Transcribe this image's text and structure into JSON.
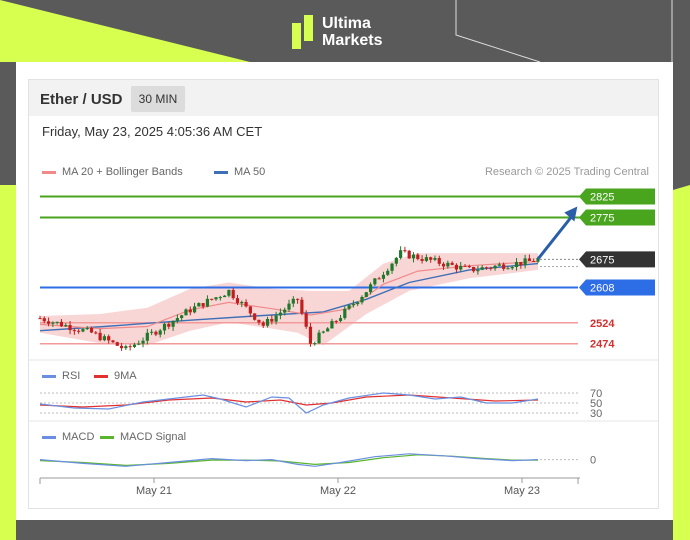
{
  "brand": {
    "line1": "Ultima",
    "line2": "Markets"
  },
  "header": {
    "symbol": "Ether / USD",
    "interval": "30 MIN"
  },
  "datetime": "Friday, May 23, 2025 4:05:36 AM CET",
  "colors": {
    "lime": "#d7ff4f",
    "green_level": "#4aa51e",
    "blue_level": "#2d6ee6",
    "red_level": "#f29a9a",
    "current": "#333333",
    "ma20": "#f08a8a",
    "ma50": "#3f6fb6",
    "rsi": "#6b8fe0",
    "nine_ma": "#e03030",
    "macd": "#6b8fe0",
    "macd_signal": "#5ab52e",
    "candle_up": "#1e7a2a",
    "candle_down": "#c21e1e",
    "band": "#f8cccc"
  },
  "chart_data": [
    {
      "type": "candlestick",
      "legend": [
        {
          "name": "MA 20 + Bollinger Bands",
          "color": "#f08a8a"
        },
        {
          "name": "MA 50",
          "color": "#3f6fb6"
        }
      ],
      "credit": "Research © 2025 Trading Central",
      "x_ticks": [
        "May 21",
        "May 22",
        "May 23"
      ],
      "ylim": [
        2440,
        2850
      ],
      "levels": [
        {
          "value": 2825,
          "label": "2825",
          "kind": "resistance"
        },
        {
          "value": 2775,
          "label": "2775",
          "kind": "resistance"
        },
        {
          "value": 2675,
          "label": "2675",
          "kind": "current"
        },
        {
          "value": 2608,
          "label": "2608",
          "kind": "pivot"
        },
        {
          "value": 2524,
          "label": "2524",
          "kind": "support"
        },
        {
          "value": 2474,
          "label": "2474",
          "kind": "support"
        }
      ],
      "path_segments": [
        [
          0,
          2535
        ],
        [
          12,
          2500
        ],
        [
          20,
          2460
        ],
        [
          35,
          2555
        ],
        [
          44,
          2600
        ],
        [
          52,
          2518
        ],
        [
          60,
          2580
        ],
        [
          63,
          2475
        ],
        [
          66,
          2500
        ],
        [
          76,
          2600
        ],
        [
          84,
          2690
        ],
        [
          100,
          2650
        ],
        [
          114,
          2670
        ],
        [
          116,
          2676
        ]
      ],
      "bollinger_upper_points": [
        [
          0,
          2540
        ],
        [
          14,
          2545
        ],
        [
          25,
          2560
        ],
        [
          35,
          2605
        ],
        [
          44,
          2620
        ],
        [
          54,
          2605
        ],
        [
          63,
          2600
        ],
        [
          72,
          2600
        ],
        [
          80,
          2665
        ],
        [
          88,
          2690
        ],
        [
          100,
          2690
        ],
        [
          116,
          2690
        ]
      ],
      "bollinger_lower_points": [
        [
          0,
          2500
        ],
        [
          14,
          2475
        ],
        [
          25,
          2470
        ],
        [
          35,
          2505
        ],
        [
          44,
          2525
        ],
        [
          54,
          2510
        ],
        [
          60,
          2500
        ],
        [
          66,
          2470
        ],
        [
          76,
          2545
        ],
        [
          86,
          2600
        ],
        [
          100,
          2630
        ],
        [
          116,
          2650
        ]
      ],
      "ma50_points": [
        [
          0,
          2505
        ],
        [
          15,
          2515
        ],
        [
          35,
          2530
        ],
        [
          50,
          2540
        ],
        [
          66,
          2550
        ],
        [
          76,
          2580
        ],
        [
          86,
          2620
        ],
        [
          100,
          2650
        ],
        [
          116,
          2665
        ]
      ],
      "forecast_arrow": {
        "from": [
          116,
          2676
        ],
        "to": [
          124,
          2825
        ]
      }
    },
    {
      "type": "line",
      "legend": [
        {
          "name": "RSI",
          "color": "#6b8fe0"
        },
        {
          "name": "9MA",
          "color": "#e03030"
        }
      ],
      "y_ticks": [
        70,
        50,
        30
      ],
      "ylim": [
        20,
        80
      ],
      "rsi_points": [
        [
          0,
          48
        ],
        [
          8,
          40
        ],
        [
          16,
          38
        ],
        [
          24,
          52
        ],
        [
          32,
          60
        ],
        [
          38,
          66
        ],
        [
          42,
          58
        ],
        [
          48,
          42
        ],
        [
          54,
          62
        ],
        [
          58,
          60
        ],
        [
          62,
          30
        ],
        [
          66,
          46
        ],
        [
          72,
          60
        ],
        [
          80,
          70
        ],
        [
          86,
          66
        ],
        [
          92,
          58
        ],
        [
          98,
          62
        ],
        [
          104,
          50
        ],
        [
          110,
          50
        ],
        [
          116,
          58
        ]
      ],
      "nine_ma_points": [
        [
          0,
          46
        ],
        [
          10,
          42
        ],
        [
          20,
          46
        ],
        [
          30,
          56
        ],
        [
          40,
          60
        ],
        [
          48,
          52
        ],
        [
          56,
          56
        ],
        [
          62,
          46
        ],
        [
          68,
          50
        ],
        [
          76,
          62
        ],
        [
          86,
          66
        ],
        [
          96,
          60
        ],
        [
          106,
          54
        ],
        [
          116,
          56
        ]
      ]
    },
    {
      "type": "line",
      "legend": [
        {
          "name": "MACD",
          "color": "#6b8fe0"
        },
        {
          "name": "MACD Signal",
          "color": "#5ab52e"
        }
      ],
      "y_ticks": [
        0
      ],
      "ylim": [
        -30,
        20
      ],
      "macd_points": [
        [
          0,
          0
        ],
        [
          10,
          -8
        ],
        [
          20,
          -14
        ],
        [
          30,
          -6
        ],
        [
          40,
          2
        ],
        [
          48,
          -2
        ],
        [
          54,
          0
        ],
        [
          60,
          -10
        ],
        [
          64,
          -14
        ],
        [
          70,
          -6
        ],
        [
          78,
          6
        ],
        [
          86,
          12
        ],
        [
          94,
          8
        ],
        [
          102,
          2
        ],
        [
          110,
          -2
        ],
        [
          116,
          0
        ]
      ],
      "signal_points": [
        [
          0,
          -2
        ],
        [
          10,
          -6
        ],
        [
          20,
          -12
        ],
        [
          30,
          -8
        ],
        [
          40,
          -1
        ],
        [
          48,
          -1
        ],
        [
          56,
          -3
        ],
        [
          64,
          -10
        ],
        [
          72,
          -6
        ],
        [
          80,
          4
        ],
        [
          88,
          10
        ],
        [
          96,
          7
        ],
        [
          104,
          2
        ],
        [
          110,
          -1
        ],
        [
          116,
          -1
        ]
      ]
    }
  ]
}
